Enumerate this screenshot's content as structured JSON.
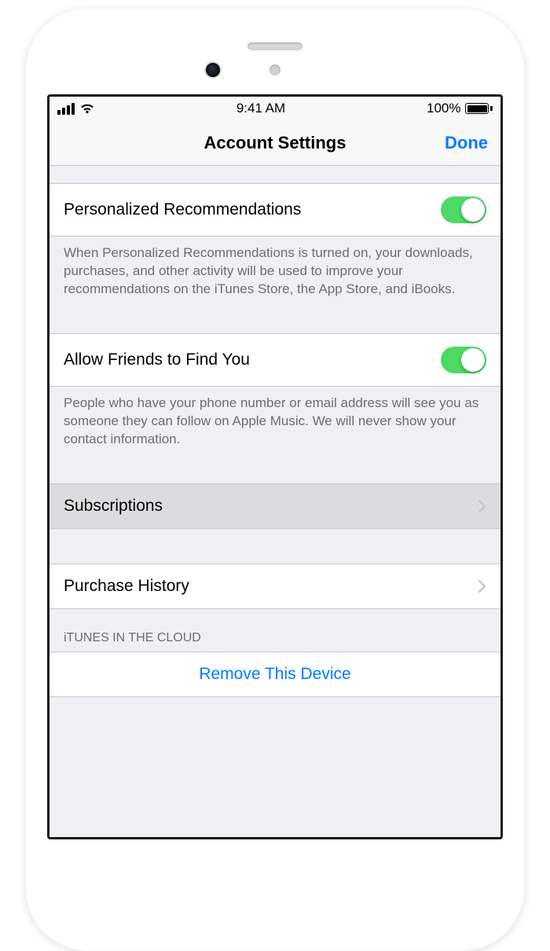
{
  "status": {
    "time": "9:41 AM",
    "battery_pct": "100%"
  },
  "nav": {
    "title": "Account Settings",
    "done": "Done"
  },
  "rows": {
    "personalized": {
      "label": "Personalized Recommendations",
      "footer": "When Personalized Recommendations is turned on, your downloads, purchases, and other activity will be used to improve your recommendations on the iTunes Store, the App Store, and iBooks."
    },
    "friends": {
      "label": "Allow Friends to Find You",
      "footer": "People who have your phone number or email address will see you as someone they can follow on Apple Music. We will never show your contact information."
    },
    "subscriptions": {
      "label": "Subscriptions"
    },
    "purchase_history": {
      "label": "Purchase History"
    },
    "cloud_header": "iTUNES IN THE CLOUD",
    "remove_device": {
      "label": "Remove This Device"
    }
  }
}
